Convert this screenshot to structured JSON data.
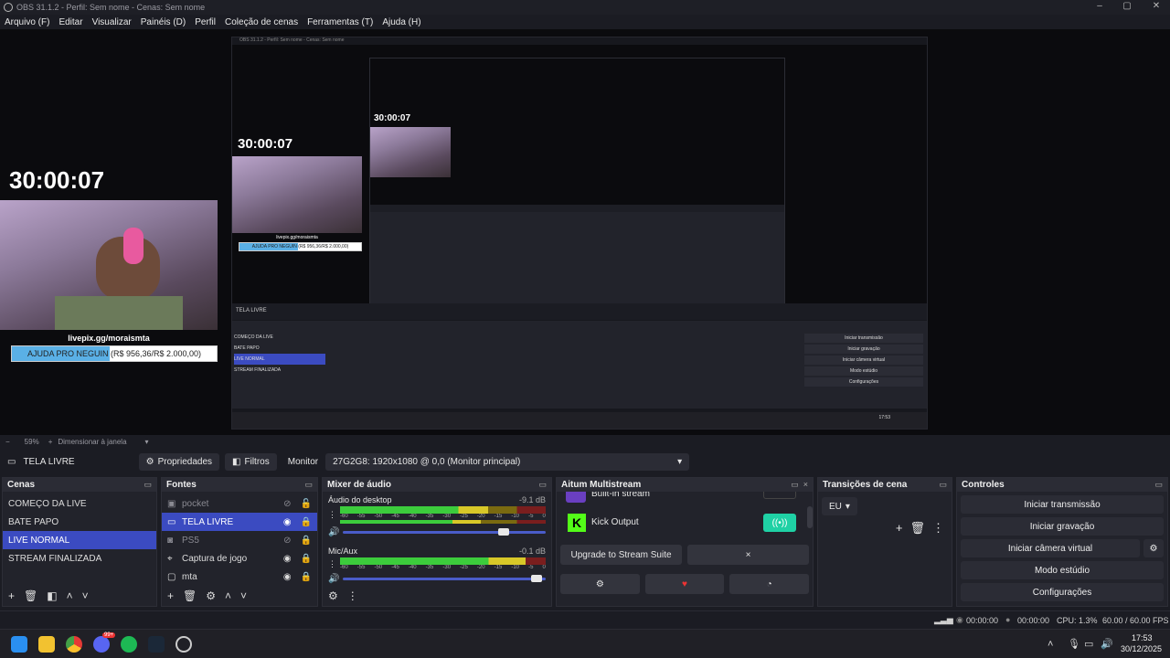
{
  "window": {
    "title": "OBS 31.1.2 - Perfil: Sem nome - Cenas: Sem nome"
  },
  "menu": [
    "Arquivo (F)",
    "Editar",
    "Visualizar",
    "Painéis (D)",
    "Perfil",
    "Coleção de cenas",
    "Ferramentas (T)",
    "Ajuda (H)"
  ],
  "preview": {
    "timer": "30:00:07",
    "cam_caption": "livepix.gg/moraismta",
    "donation_label": "AJUDA PRO NEGUIN (R$ 956,36/R$ 2.000,00)",
    "donation_progress": 0.478
  },
  "zoom": {
    "value": "59%",
    "mode": "Dimensionar à janela"
  },
  "context": {
    "source": "TELA LIVRE",
    "properties": "Propriedades",
    "filters": "Filtros",
    "monitor_label": "Monitor",
    "monitor_value": "27G2G8: 1920x1080 @ 0,0 (Monitor principal)"
  },
  "scenes": {
    "title": "Cenas",
    "items": [
      "COMEÇO DA LIVE",
      "BATE PAPO",
      "LIVE NORMAL",
      "STREAM FINALIZADA"
    ],
    "selected": 2
  },
  "sources": {
    "title": "Fontes",
    "items": [
      {
        "name": "pocket",
        "icon": "image-icon",
        "visible": false
      },
      {
        "name": "TELA LIVRE",
        "icon": "monitor-icon",
        "visible": true,
        "selected": true
      },
      {
        "name": "PS5",
        "icon": "camera-icon",
        "visible": false
      },
      {
        "name": "Captura de jogo",
        "icon": "gamepad-icon",
        "visible": true
      },
      {
        "name": "mta",
        "icon": "window-icon",
        "visible": true
      }
    ]
  },
  "mixer": {
    "title": "Mixer de áudio",
    "channels": [
      {
        "name": "Áudio do desktop",
        "db": "-9.1 dB",
        "level": 0.72,
        "volume": 0.82
      },
      {
        "name": "Mic/Aux",
        "db": "-0.1 dB",
        "level": 0.9,
        "volume": 0.98
      }
    ],
    "scale": [
      "-60",
      "-55",
      "-50",
      "-45",
      "-40",
      "-35",
      "-30",
      "-25",
      "-20",
      "-15",
      "-10",
      "-5",
      "0"
    ]
  },
  "multistream": {
    "title": "Aitum Multistream",
    "partial_item": "Built-in stream",
    "kick_label": "Kick Output",
    "upgrade": "Upgrade to Stream Suite",
    "close_symbol": "×"
  },
  "transitions": {
    "title": "Transições de cena",
    "value": "EU"
  },
  "controls": {
    "title": "Controles",
    "buttons": [
      "Iniciar transmissão",
      "Iniciar gravação",
      "Iniciar câmera virtual",
      "Modo estúdio",
      "Configurações"
    ]
  },
  "status": {
    "time1": "00:00:00",
    "time2": "00:00:00",
    "cpu": "CPU: 1.3%",
    "fps": "60.00 / 60.00 FPS"
  },
  "taskbar": {
    "time": "17:53",
    "date": "30/12/2025",
    "badge": "99+"
  },
  "colors": {
    "accent": "#3b4bc1",
    "kick": "#53fc18",
    "record_toggle": "#1fd1a5"
  }
}
